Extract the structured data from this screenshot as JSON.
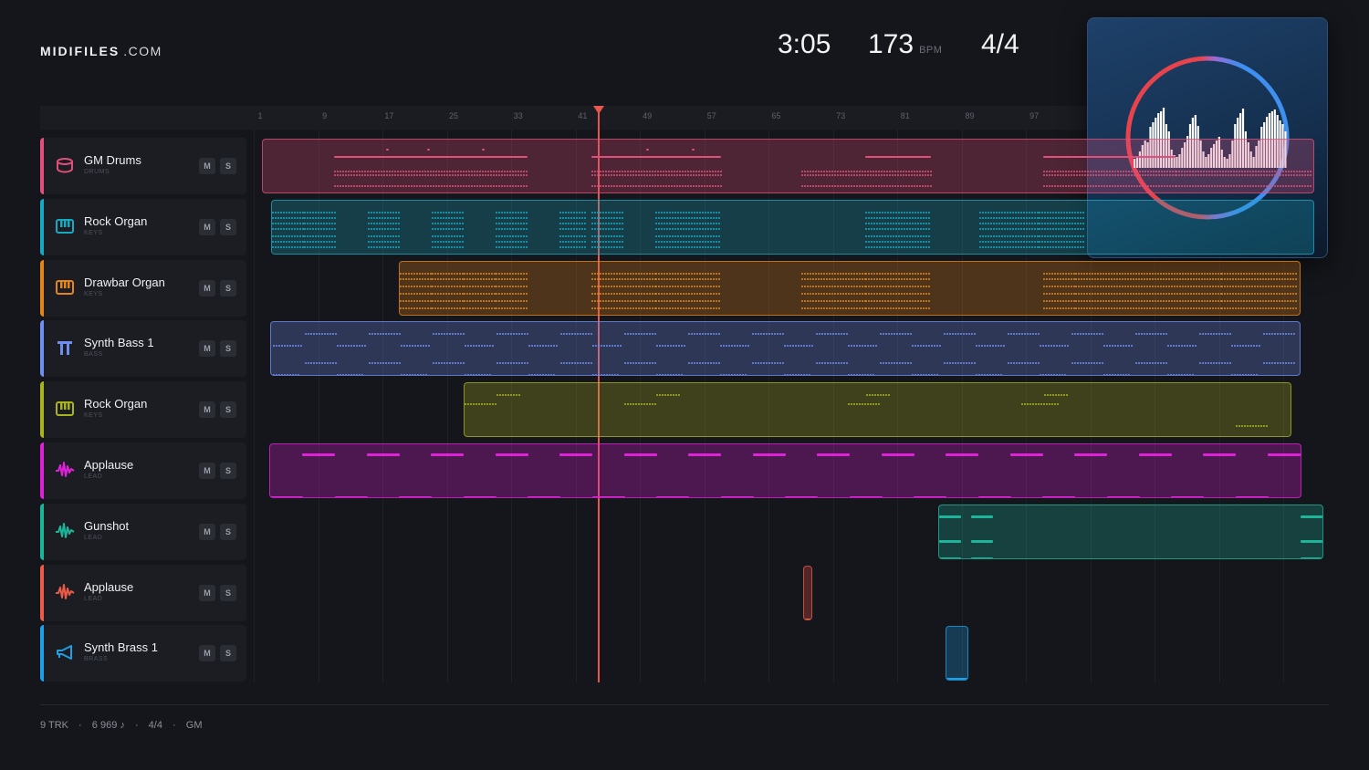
{
  "brand": {
    "bold": "MIDIFILES",
    "domain": ".COM"
  },
  "header": {
    "time": "3:05",
    "tempo": "173",
    "tempo_unit": "BPM",
    "time_signature": "4/4"
  },
  "ruler": {
    "bars": [
      "1",
      "9",
      "17",
      "25",
      "33",
      "41",
      "49",
      "57",
      "65",
      "73",
      "81",
      "89",
      "97"
    ]
  },
  "playhead": {
    "bar": 42
  },
  "tracks": [
    {
      "name": "GM Drums",
      "category": "DRUMS",
      "color": "#e0507a",
      "icon": "drum-icon",
      "mute": "M",
      "solo": "S"
    },
    {
      "name": "Rock Organ",
      "category": "KEYS",
      "color": "#17a9c2",
      "icon": "piano-icon",
      "mute": "M",
      "solo": "S"
    },
    {
      "name": "Drawbar Organ",
      "category": "KEYS",
      "color": "#e2861c",
      "icon": "piano-icon",
      "mute": "M",
      "solo": "S"
    },
    {
      "name": "Synth Bass 1",
      "category": "BASS",
      "color": "#6f8ef0",
      "icon": "bass-icon",
      "mute": "M",
      "solo": "S"
    },
    {
      "name": "Rock Organ",
      "category": "KEYS",
      "color": "#a8b41e",
      "icon": "piano-icon",
      "mute": "M",
      "solo": "S"
    },
    {
      "name": "Applause",
      "category": "LEAD",
      "color": "#de22d8",
      "icon": "wave-icon",
      "mute": "M",
      "solo": "S"
    },
    {
      "name": "Gunshot",
      "category": "LEAD",
      "color": "#1bb59a",
      "icon": "wave-icon",
      "mute": "M",
      "solo": "S"
    },
    {
      "name": "Applause",
      "category": "LEAD",
      "color": "#ec5a48",
      "icon": "wave-icon",
      "mute": "M",
      "solo": "S"
    },
    {
      "name": "Synth Brass 1",
      "category": "BRASS",
      "color": "#1e9fe6",
      "icon": "horn-icon",
      "mute": "M",
      "solo": "S"
    }
  ],
  "footer": {
    "tracks": "9 TRK",
    "notes": "6 969 ♪",
    "time_signature": "4/4",
    "standard": "GM",
    "separator": "·"
  },
  "album_art": {
    "icon": "waveform-ring-icon"
  }
}
